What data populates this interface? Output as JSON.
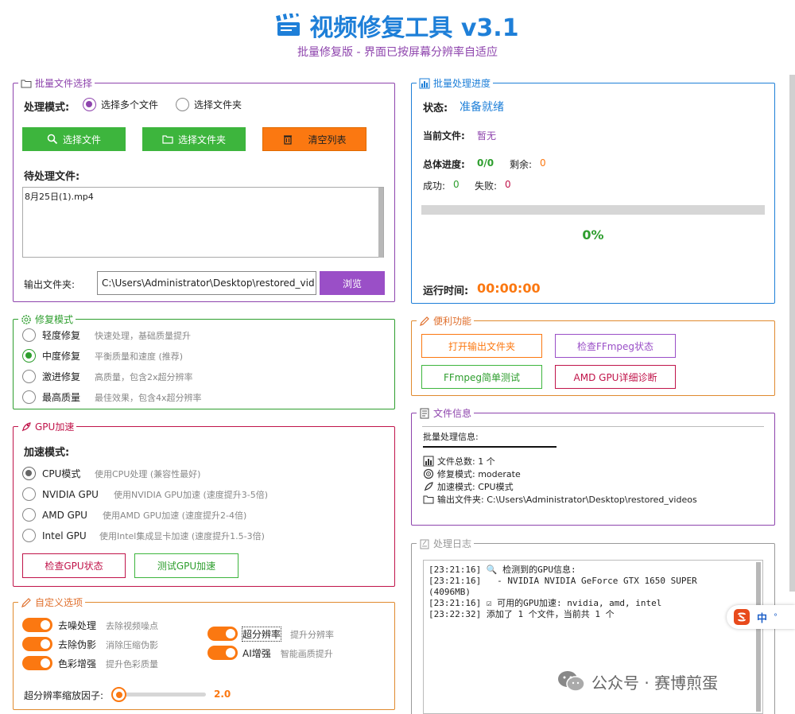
{
  "header": {
    "title": "视频修复工具 v3.1",
    "subtitle": "批量修复版 - 界面已按屏幕分辨率自适应"
  },
  "file_select": {
    "legend": "批量文件选择",
    "mode_label": "处理模式:",
    "mode_options": [
      "选择多个文件",
      "选择文件夹"
    ],
    "selected_mode": "选择多个文件",
    "btn_select_files": "选择文件",
    "btn_select_folder": "选择文件夹",
    "btn_clear": "清空列表",
    "pending_label": "待处理文件:",
    "pending_files": [
      "8月25日(1).mp4"
    ],
    "output_label": "输出文件夹:",
    "output_value": "C:\\Users\\Administrator\\Desktop\\restored_vid",
    "btn_browse": "浏览"
  },
  "progress": {
    "legend": "批量处理进度",
    "status_label": "状态:",
    "status_value": "准备就绪",
    "current_label": "当前文件:",
    "current_value": "暂无",
    "total_label": "总体进度:",
    "total_value": "0/0",
    "remaining_label": "剩余:",
    "remaining_value": "0",
    "success_label": "成功:",
    "success_value": "0",
    "fail_label": "失败:",
    "fail_value": "0",
    "percent": "0%",
    "percent_fraction": 0,
    "runtime_label": "运行时间:",
    "runtime_value": "00:00:00"
  },
  "repair_mode": {
    "legend": "修复模式",
    "options": [
      {
        "label": "轻度修复",
        "desc": "快速处理，基础质量提升"
      },
      {
        "label": "中度修复",
        "desc": "平衡质量和速度 (推荐)"
      },
      {
        "label": "激进修复",
        "desc": "高质量，包含2x超分辨率"
      },
      {
        "label": "最高质量",
        "desc": "最佳效果，包含4x超分辨率"
      }
    ],
    "selected": "中度修复"
  },
  "convenience": {
    "legend": "便利功能",
    "btn_open_output": "打开输出文件夹",
    "btn_check_ffmpeg": "检查FFmpeg状态",
    "btn_ffmpeg_test": "FFmpeg简单测试",
    "btn_amd_diag": "AMD GPU详细诊断"
  },
  "gpu": {
    "legend": "GPU加速",
    "mode_label": "加速模式:",
    "options": [
      {
        "label": "CPU模式",
        "desc": "使用CPU处理 (兼容性最好)"
      },
      {
        "label": "NVIDIA GPU",
        "desc": "使用NVIDIA GPU加速 (速度提升3-5倍)"
      },
      {
        "label": "AMD GPU",
        "desc": "使用AMD GPU加速 (速度提升2-4倍)"
      },
      {
        "label": "Intel GPU",
        "desc": "使用Intel集成显卡加速 (速度提升1.5-3倍)"
      }
    ],
    "selected": "CPU模式",
    "btn_check": "检查GPU状态",
    "btn_test": "测试GPU加速"
  },
  "file_info": {
    "legend": "文件信息",
    "heading": "批量处理信息:",
    "lines": [
      "文件总数: 1 个",
      "修复模式: moderate",
      "加速模式: CPU模式",
      "输出文件夹: C:\\Users\\Administrator\\Desktop\\restored_videos"
    ]
  },
  "custom": {
    "legend": "自定义选项",
    "toggles_left": [
      {
        "label": "去噪处理",
        "desc": "去除视频噪点"
      },
      {
        "label": "去除伪影",
        "desc": "消除压缩伪影"
      },
      {
        "label": "色彩增强",
        "desc": "提升色彩质量"
      }
    ],
    "toggles_right": [
      {
        "label": "超分辨率",
        "desc": "提升分辨率"
      },
      {
        "label": "AI增强",
        "desc": "智能画质提升"
      }
    ],
    "slider_label": "超分辨率缩放因子:",
    "slider_value": "2.0",
    "slider_fraction": 0
  },
  "log": {
    "legend": "处理日志",
    "lines": [
      "[23:21:16] 🔍 检测到的GPU信息:",
      "[23:21:16]   - NVIDIA NVIDIA GeForce GTX 1650 SUPER",
      "(4096MB)",
      "[23:21:16] ☑ 可用的GPU加速: nvidia, amd, intel",
      "[23:22:32] 添加了 1 个文件，当前共 1 个"
    ]
  },
  "overlay": {
    "ime_label": "中",
    "watermark": "公众号 · 赛博煎蛋"
  },
  "colors": {
    "blue": "#1e7fd8",
    "purple": "#8e44ad",
    "green": "#2e9e2e",
    "orange": "#fb7811",
    "crimson": "#c0144a"
  }
}
